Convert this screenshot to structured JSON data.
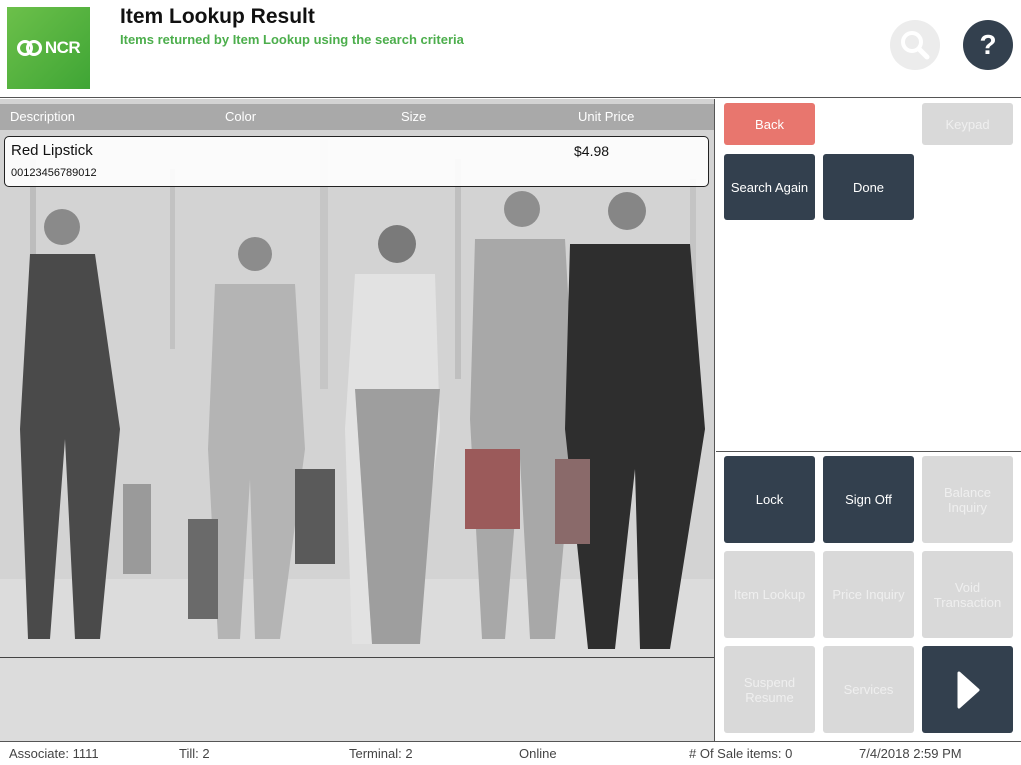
{
  "header": {
    "logo_text": "NCR",
    "title": "Item Lookup Result",
    "subtitle": "Items returned by Item Lookup using the search criteria",
    "search_icon": "magnifier-icon",
    "help_label": "?"
  },
  "grid": {
    "columns": [
      "Description",
      "Color",
      "Size",
      "Unit Price"
    ],
    "rows": [
      {
        "description": "Red Lipstick",
        "code": "00123456789012",
        "color": "",
        "size": "",
        "unit_price": "$4.98"
      }
    ]
  },
  "actions": {
    "back": "Back",
    "keypad": "Keypad",
    "search_again": "Search Again",
    "done": "Done"
  },
  "menu": {
    "lock": "Lock",
    "sign_off": "Sign Off",
    "balance_inquiry": "Balance Inquiry",
    "item_lookup": "Item Lookup",
    "price_inquiry": "Price Inquiry",
    "void_transaction": "Void Transaction",
    "suspend_resume": "Suspend Resume",
    "services": "Services",
    "next_icon": "play-arrow-icon"
  },
  "status_bar": {
    "associate": "Associate: 1111",
    "till": "Till: 2",
    "terminal": "Terminal: 2",
    "connection": "Online",
    "sale_items": "# Of Sale items: 0",
    "datetime": "7/4/2018 2:59 PM"
  },
  "colors": {
    "brand_green": "#4cae4c",
    "dark_button": "#33404e",
    "back_button": "#e8766e",
    "disabled_button": "#d9d9d9"
  }
}
